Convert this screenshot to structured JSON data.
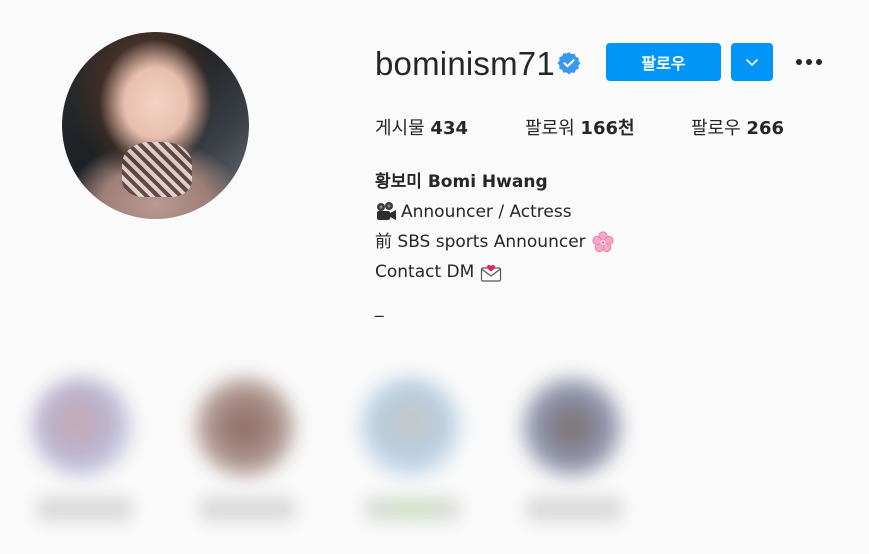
{
  "profile": {
    "username": "bominism71",
    "follow_label": "팔로우",
    "stats": {
      "posts_label": "게시물",
      "posts_value": "434",
      "followers_label": "팔로워",
      "followers_value": "166천",
      "following_label": "팔로우",
      "following_value": "266"
    },
    "bio": {
      "name": "황보미 Bomi Hwang",
      "line1": "Announcer / Actress",
      "line2": "前 SBS sports Announcer",
      "line3": "Contact DM",
      "line4": "_"
    }
  },
  "icons": {
    "verified": "verified-badge-icon",
    "dropdown": "chevron-down-icon",
    "more": "more-options-icon",
    "camera": "movie-camera-icon",
    "flower": "cherry-blossom-icon",
    "mail": "love-letter-icon"
  },
  "colors": {
    "accent": "#0095f6",
    "text": "#262626",
    "background": "#fafafa"
  }
}
